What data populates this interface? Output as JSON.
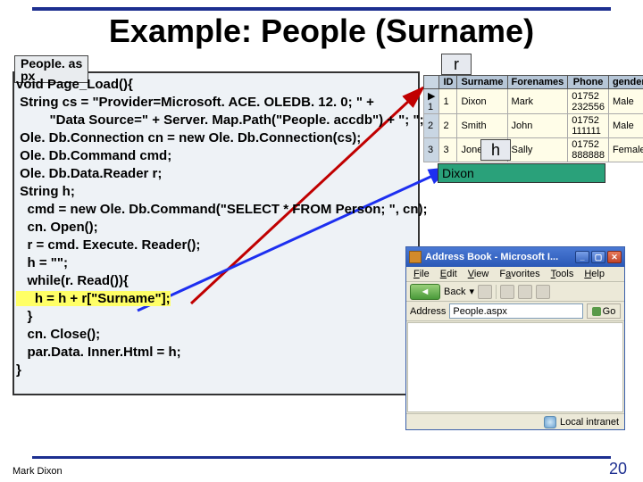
{
  "title": "Example: People (Surname)",
  "footer": {
    "author": "Mark Dixon",
    "page": "20"
  },
  "file_label": "People. as\npx",
  "code_lines": [
    "void Page_Load(){",
    " String cs = \"Provider=Microsoft. ACE. OLEDB. 12. 0; \" +",
    "         \"Data Source=\" + Server. Map.Path(\"People. accdb\") + \"; \";",
    " Ole. Db.Connection cn = new Ole. Db.Connection(cs);",
    " Ole. Db.Command cmd;",
    " Ole. Db.Data.Reader r;",
    " String h;",
    "   cmd = new Ole. Db.Command(\"SELECT * FROM Person; \", cn);",
    "   cn. Open();",
    "   r = cmd. Execute. Reader();",
    "   h = \"\";",
    "   while(r. Read()){",
    "     h = h + r[\"Surname\"];",
    "   }",
    "   cn. Close();",
    "   par.Data. Inner.Html = h;",
    "}"
  ],
  "highlight_line_index": 12,
  "highlight_text": "     h = h + r[\"Surname\"];",
  "r_label": "r",
  "h_label": "h",
  "dixon_value": "Dixon",
  "table": {
    "headers": [
      "ID",
      "Surname",
      "Forenames",
      "Phone",
      "gender"
    ],
    "rows": [
      [
        "1",
        "Dixon",
        "Mark",
        "01752 232556",
        "Male"
      ],
      [
        "2",
        "Smith",
        "John",
        "01752 111111",
        "Male"
      ],
      [
        "3",
        "Jones",
        "Sally",
        "01752 888888",
        "Female"
      ]
    ]
  },
  "browser": {
    "title": "Address Book - Microsoft I...",
    "menus": [
      {
        "u": "F",
        "rest": "ile"
      },
      {
        "u": "E",
        "rest": "dit"
      },
      {
        "u": "V",
        "rest": "iew"
      },
      {
        "u": "F",
        "rest": "avorites",
        "pre": "",
        "und": "a",
        "pretext": "F",
        "post": "vorites"
      },
      {
        "u": "T",
        "rest": "ools"
      },
      {
        "u": "H",
        "rest": "elp"
      }
    ],
    "back_label": "Back",
    "address_label": "Address",
    "address_value": "People.aspx",
    "go_label": "Go",
    "status_text": "Local intranet"
  }
}
